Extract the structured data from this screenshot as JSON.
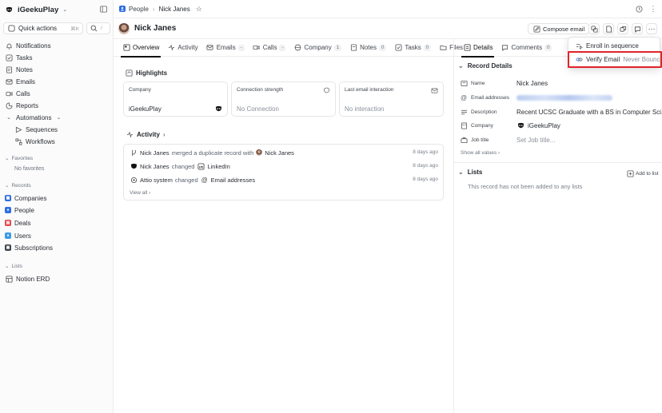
{
  "workspace": {
    "name": "iGeekuPlay"
  },
  "sidebar": {
    "quick_actions": {
      "label": "Quick actions",
      "shortcut": "⌘K",
      "search_shortcut": "/"
    },
    "items": [
      {
        "label": "Notifications",
        "icon": "bell-icon"
      },
      {
        "label": "Tasks",
        "icon": "checkbox-icon"
      },
      {
        "label": "Notes",
        "icon": "note-icon"
      },
      {
        "label": "Emails",
        "icon": "mail-icon"
      },
      {
        "label": "Calls",
        "icon": "video-icon"
      },
      {
        "label": "Reports",
        "icon": "chart-icon"
      },
      {
        "label": "Automations",
        "icon": "automation-icon"
      }
    ],
    "automations_children": [
      {
        "label": "Sequences",
        "icon": "sequence-icon"
      },
      {
        "label": "Workflows",
        "icon": "workflow-icon"
      }
    ],
    "favorites": {
      "label": "Favorites",
      "empty": "No favorites"
    },
    "records": {
      "label": "Records",
      "items": [
        {
          "label": "Companies",
          "color": "#2f6fe4"
        },
        {
          "label": "People",
          "color": "#2f6fe4"
        },
        {
          "label": "Deals",
          "color": "#e5484d"
        },
        {
          "label": "Users",
          "color": "#3b9be8"
        },
        {
          "label": "Subscriptions",
          "color": "#3e434b"
        }
      ]
    },
    "lists": {
      "label": "Lists",
      "items": [
        {
          "label": "Notion ERD"
        }
      ]
    }
  },
  "breadcrumb": {
    "object": "People",
    "record": "Nick Janes"
  },
  "record": {
    "name": "Nick Janes",
    "compose_label": "Compose email"
  },
  "tabs": [
    {
      "label": "Overview",
      "count": null,
      "active": true
    },
    {
      "label": "Activity",
      "count": null
    },
    {
      "label": "Emails",
      "count": "-"
    },
    {
      "label": "Calls",
      "count": "-"
    },
    {
      "label": "Company",
      "count": "1"
    },
    {
      "label": "Notes",
      "count": "0"
    },
    {
      "label": "Tasks",
      "count": "0"
    },
    {
      "label": "Files",
      "count": null
    }
  ],
  "highlights": {
    "title": "Highlights",
    "cards": [
      {
        "label": "Company",
        "value": "iGeekuPlay"
      },
      {
        "label": "Connection strength",
        "value": "No Connection"
      },
      {
        "label": "Last email interaction",
        "value": "No interaction"
      }
    ]
  },
  "activity": {
    "title": "Activity",
    "rows": [
      {
        "actor": "Nick Janes",
        "action": "merged a duplicate record with",
        "target": "Nick Janes",
        "date": "8 days ago"
      },
      {
        "actor": "Nick Janes",
        "action": "changed",
        "target": "LinkedIn",
        "date": "8 days ago"
      },
      {
        "actor": "Attio system",
        "action": "changed",
        "target": "Email addresses",
        "date": "8 days ago"
      }
    ],
    "view_all": "View all"
  },
  "right_panel": {
    "tabs": [
      {
        "label": "Details",
        "active": true
      },
      {
        "label": "Comments",
        "count": "0"
      }
    ],
    "record_details": {
      "title": "Record Details",
      "fields": [
        {
          "label": "Name",
          "value": "Nick Janes"
        },
        {
          "label": "Email addresses",
          "value": ""
        },
        {
          "label": "Description",
          "value": "Recent UCSC Graduate with a BS in Computer Sci..."
        },
        {
          "label": "Company",
          "value": "iGeekuPlay"
        },
        {
          "label": "Job title",
          "value": "Set Job title..."
        }
      ],
      "show_all": "Show all values"
    },
    "lists": {
      "title": "Lists",
      "add": "Add to list",
      "empty": "This record has not been added to any lists"
    }
  },
  "dropdown": {
    "items": [
      {
        "label": "Enroll in sequence",
        "sub": ""
      },
      {
        "label": "Verify Email",
        "sub": "Never Bounce"
      }
    ]
  },
  "colors": {
    "highlight_box": "#e0242a",
    "people_tile": "#2f6fe4"
  }
}
